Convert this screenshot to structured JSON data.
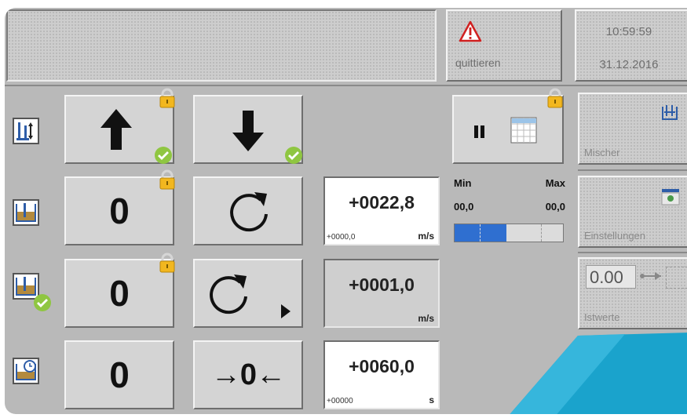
{
  "alarm": {
    "ack_label": "quittieren"
  },
  "clock": {
    "time": "10:59:59",
    "date": "31.12.2016"
  },
  "side": {
    "mixer": "Mischer",
    "settings": "Einstellungen",
    "actual": "Istwerte",
    "actual_value": "0.00"
  },
  "rows": {
    "speed": {
      "zero": "0",
      "value": "+0022,8",
      "sub": "+0000,0",
      "unit": "m/s"
    },
    "speed2": {
      "zero": "0",
      "value": "+0001,0",
      "unit": "m/s"
    },
    "time": {
      "zero": "0",
      "value": "+0060,0",
      "sub": "+00000",
      "unit": "s",
      "reset_label": "→0←"
    }
  },
  "gauge": {
    "min_label": "Min",
    "max_label": "Max",
    "min_value": "00,0",
    "max_value": "00,0",
    "fill_fraction": 0.48
  },
  "colors": {
    "background": "#b9b9b9",
    "gauge_fill": "#2f6fd0",
    "lock": "#f2b71f",
    "check": "#8fc641",
    "accent_teal": "#1aa3cc"
  },
  "icons": [
    "alert-triangle-icon",
    "lock-icon",
    "check-icon",
    "arrow-up-icon",
    "arrow-down-icon",
    "pause-icon",
    "grid-icon",
    "mixer-icon",
    "eye-icon",
    "refresh-icon",
    "play-right-icon",
    "clock-icon"
  ]
}
